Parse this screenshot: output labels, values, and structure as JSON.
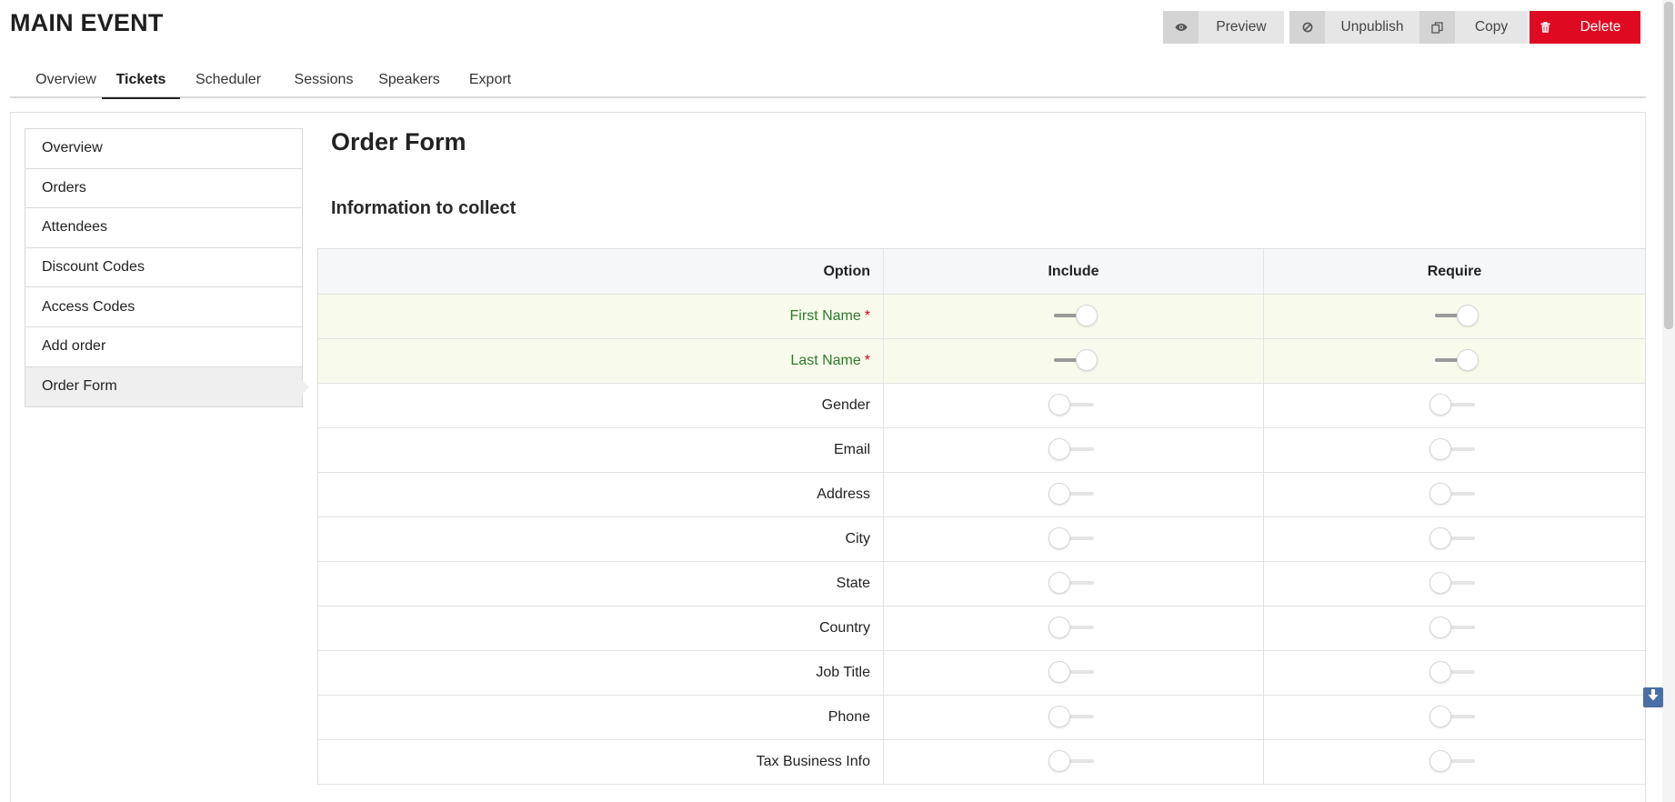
{
  "title": "MAIN EVENT",
  "actions": {
    "preview": "Preview",
    "unpublish": "Unpublish",
    "copy": "Copy",
    "delete": "Delete"
  },
  "tabs": [
    "Overview",
    "Tickets",
    "Scheduler",
    "Sessions",
    "Speakers",
    "Export"
  ],
  "active_tab": "Tickets",
  "sidebar": {
    "items": [
      "Overview",
      "Orders",
      "Attendees",
      "Discount Codes",
      "Access Codes",
      "Add order",
      "Order Form"
    ],
    "active": "Order Form"
  },
  "content": {
    "title": "Order Form",
    "section": "Information to collect"
  },
  "table": {
    "headers": {
      "option": "Option",
      "include": "Include",
      "require": "Require"
    },
    "required_marker": "*",
    "rows": [
      {
        "label": "First Name",
        "required": true,
        "include": true,
        "require": true
      },
      {
        "label": "Last Name",
        "required": true,
        "include": true,
        "require": true
      },
      {
        "label": "Gender",
        "required": false,
        "include": false,
        "require": false
      },
      {
        "label": "Email",
        "required": false,
        "include": false,
        "require": false
      },
      {
        "label": "Address",
        "required": false,
        "include": false,
        "require": false
      },
      {
        "label": "City",
        "required": false,
        "include": false,
        "require": false
      },
      {
        "label": "State",
        "required": false,
        "include": false,
        "require": false
      },
      {
        "label": "Country",
        "required": false,
        "include": false,
        "require": false
      },
      {
        "label": "Job Title",
        "required": false,
        "include": false,
        "require": false
      },
      {
        "label": "Phone",
        "required": false,
        "include": false,
        "require": false
      },
      {
        "label": "Tax Business Info",
        "required": false,
        "include": false,
        "require": false
      }
    ]
  },
  "colors": {
    "delete": "#df0921",
    "required_row_bg": "#f8fbec",
    "required_label": "#2c7a2c",
    "required_star": "#d0021b"
  }
}
